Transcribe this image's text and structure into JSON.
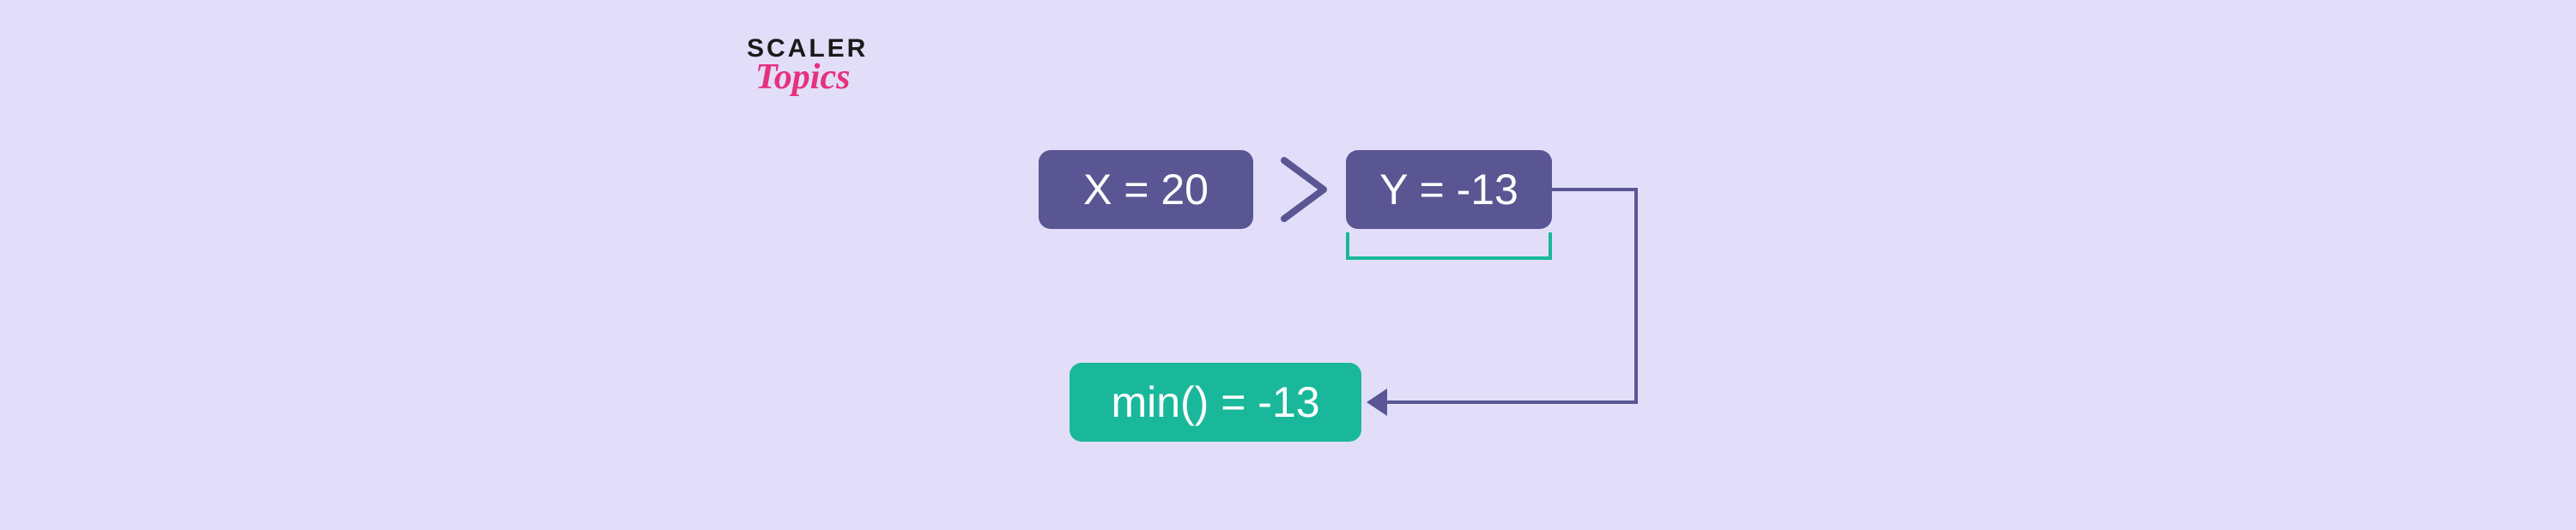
{
  "logo": {
    "line1": "SCALER",
    "line2": "Topics"
  },
  "diagram": {
    "x_label": "X = 20",
    "y_label": "Y = -13",
    "comparator": ">",
    "result_label": "min() = -13"
  },
  "colors": {
    "background": "#e2defa",
    "box_purple": "#5a5693",
    "box_teal": "#1ab89b",
    "accent_pink": "#e6317d"
  },
  "chart_data": {
    "type": "diagram",
    "inputs": {
      "X": 20,
      "Y": -13
    },
    "operation": "min()",
    "comparison": "X > Y",
    "result": -13
  }
}
